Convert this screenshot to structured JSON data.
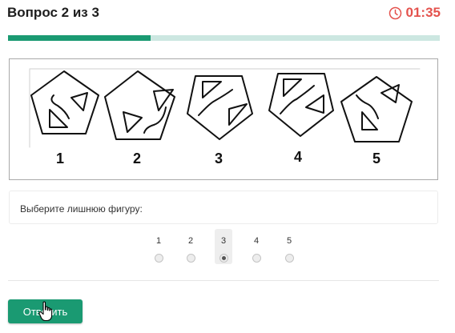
{
  "header": {
    "title": "Вопрос 2 из 3",
    "timer": "01:35",
    "timer_icon": "clock-icon"
  },
  "progress": {
    "fraction": 0.33
  },
  "figures": {
    "labels": [
      "1",
      "2",
      "3",
      "4",
      "5"
    ]
  },
  "question": {
    "prompt": "Выберите лишнюю фигуру:"
  },
  "options": {
    "items": [
      "1",
      "2",
      "3",
      "4",
      "5"
    ],
    "selected": "3"
  },
  "submit": {
    "label": "Ответить"
  },
  "colors": {
    "accent": "#1a9a72",
    "progress_track": "#cce7e1",
    "timer": "#e4524d"
  }
}
